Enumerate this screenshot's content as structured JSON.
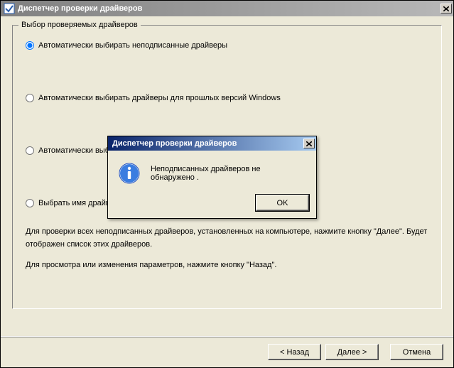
{
  "window": {
    "title": "Диспетчер проверки драйверов"
  },
  "group": {
    "legend": "Выбор проверяемых драйверов",
    "options": {
      "o1": "Автоматически выбирать неподписанные драйверы",
      "o2": "Автоматически выбирать драйверы для прошлых версий Windows",
      "o3": "Автоматически выби",
      "o4": "Выбрать имя драйвера из списка"
    },
    "info_line1": "Для проверки всех неподписанных драйверов, установленных на компьютере, нажмите кнопку \"Далее\". Будет отображен список этих драйверов.",
    "info_line2": "Для просмотра или изменения параметров, нажмите кнопку \"Назад\"."
  },
  "buttons": {
    "back": "< Назад",
    "next": "Далее >",
    "cancel": "Отмена"
  },
  "msgbox": {
    "title": "Диспетчер проверки драйверов",
    "text": "Неподписанных драйверов не обнаружено .",
    "ok": "OK"
  }
}
